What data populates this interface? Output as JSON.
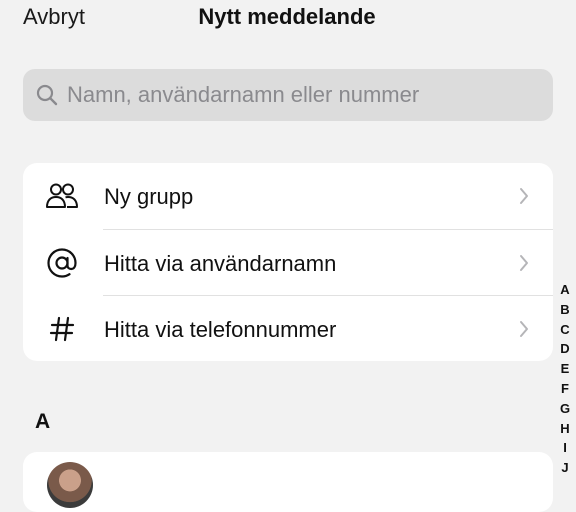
{
  "header": {
    "cancel_label": "Avbryt",
    "title": "Nytt meddelande"
  },
  "search": {
    "placeholder": "Namn, användarnamn eller nummer",
    "value": ""
  },
  "options": [
    {
      "icon": "group-icon",
      "label": "Ny grupp"
    },
    {
      "icon": "at-sign-icon",
      "label": "Hitta via användarnamn"
    },
    {
      "icon": "hash-icon",
      "label": "Hitta via telefonnummer"
    }
  ],
  "section_header": "A",
  "index_letters": [
    "A",
    "B",
    "C",
    "D",
    "E",
    "F",
    "G",
    "H",
    "I",
    "J"
  ],
  "colors": {
    "background": "#f2f2f2",
    "card": "#ffffff",
    "search_bg": "#dcdcdc",
    "secondary_text": "#8a8a8e"
  }
}
